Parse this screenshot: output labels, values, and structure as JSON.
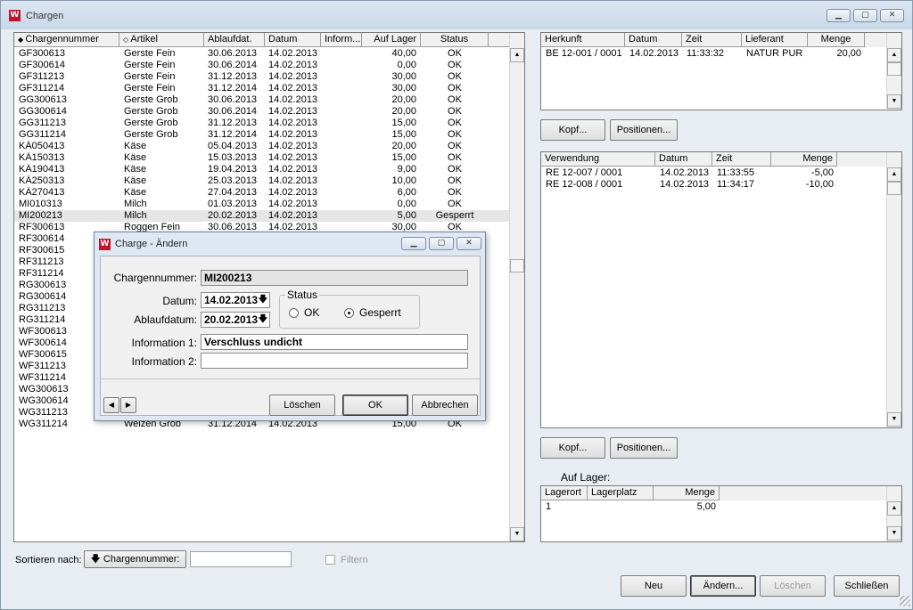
{
  "window": {
    "title": "Chargen",
    "icon": "w-app-icon",
    "controls": [
      "minimize-icon",
      "maximize-icon",
      "close-icon"
    ]
  },
  "main_table": {
    "headers": [
      "Chargennummer",
      "Artikel",
      "Ablaufdat.",
      "Datum",
      "Inform...",
      "Auf Lager",
      "Status"
    ],
    "header_markers": [
      "◆",
      "◇"
    ],
    "rows": [
      [
        "GF300613",
        "Gerste Fein",
        "30.06.2013",
        "14.02.2013",
        "",
        "40,00",
        "OK"
      ],
      [
        "GF300614",
        "Gerste Fein",
        "30.06.2014",
        "14.02.2013",
        "",
        "0,00",
        "OK"
      ],
      [
        "GF311213",
        "Gerste Fein",
        "31.12.2013",
        "14.02.2013",
        "",
        "30,00",
        "OK"
      ],
      [
        "GF311214",
        "Gerste Fein",
        "31.12.2014",
        "14.02.2013",
        "",
        "30,00",
        "OK"
      ],
      [
        "GG300613",
        "Gerste Grob",
        "30.06.2013",
        "14.02.2013",
        "",
        "20,00",
        "OK"
      ],
      [
        "GG300614",
        "Gerste Grob",
        "30.06.2014",
        "14.02.2013",
        "",
        "20,00",
        "OK"
      ],
      [
        "GG311213",
        "Gerste Grob",
        "31.12.2013",
        "14.02.2013",
        "",
        "15,00",
        "OK"
      ],
      [
        "GG311214",
        "Gerste Grob",
        "31.12.2014",
        "14.02.2013",
        "",
        "15,00",
        "OK"
      ],
      [
        "KÄ050413",
        "Käse",
        "05.04.2013",
        "14.02.2013",
        "",
        "20,00",
        "OK"
      ],
      [
        "KÄ150313",
        "Käse",
        "15.03.2013",
        "14.02.2013",
        "",
        "15,00",
        "OK"
      ],
      [
        "KÄ190413",
        "Käse",
        "19.04.2013",
        "14.02.2013",
        "",
        "9,00",
        "OK"
      ],
      [
        "KÄ250313",
        "Käse",
        "25.03.2013",
        "14.02.2013",
        "",
        "10,00",
        "OK"
      ],
      [
        "KÄ270413",
        "Käse",
        "27.04.2013",
        "14.02.2013",
        "",
        "6,00",
        "OK"
      ],
      [
        "MI010313",
        "Milch",
        "01.03.2013",
        "14.02.2013",
        "",
        "0,00",
        "OK"
      ],
      [
        "MI200213",
        "Milch",
        "20.02.2013",
        "14.02.2013",
        "",
        "5,00",
        "Gesperrt"
      ],
      [
        "RF300613",
        "Roggen Fein",
        "30.06.2013",
        "14.02.2013",
        "",
        "30,00",
        "OK"
      ],
      [
        "RF300614",
        "",
        "",
        "",
        "",
        "",
        ""
      ],
      [
        "RF300615",
        "",
        "",
        "",
        "",
        "",
        ""
      ],
      [
        "RF311213",
        "",
        "",
        "",
        "",
        "",
        ""
      ],
      [
        "RF311214",
        "",
        "",
        "",
        "",
        "",
        ""
      ],
      [
        "RG300613",
        "",
        "",
        "",
        "",
        "",
        ""
      ],
      [
        "RG300614",
        "",
        "",
        "",
        "",
        "",
        ""
      ],
      [
        "RG311213",
        "",
        "",
        "",
        "",
        "",
        ""
      ],
      [
        "RG311214",
        "",
        "",
        "",
        "",
        "",
        ""
      ],
      [
        "WF300613",
        "",
        "",
        "",
        "",
        "",
        ""
      ],
      [
        "WF300614",
        "",
        "",
        "",
        "",
        "",
        ""
      ],
      [
        "WF300615",
        "",
        "",
        "",
        "",
        "",
        ""
      ],
      [
        "WF311213",
        "",
        "",
        "",
        "",
        "",
        ""
      ],
      [
        "WF311214",
        "",
        "",
        "",
        "",
        "",
        ""
      ],
      [
        "WG300613",
        "",
        "",
        "",
        "",
        "",
        ""
      ],
      [
        "WG300614",
        "",
        "",
        "",
        "",
        "",
        ""
      ],
      [
        "WG311213",
        "",
        "",
        "",
        "",
        "",
        ""
      ],
      [
        "WG311214",
        "Weizen Grob",
        "31.12.2014",
        "14.02.2013",
        "",
        "15,00",
        "OK"
      ]
    ],
    "selected_row": "MI200213"
  },
  "herkunft_table": {
    "headers": [
      "Herkunft",
      "Datum",
      "Zeit",
      "Lieferant",
      "Menge"
    ],
    "rows": [
      [
        "BE 12-001 / 0001",
        "14.02.2013",
        "11:33:32",
        "NATUR PUR",
        "20,00"
      ]
    ]
  },
  "herkunft_buttons": {
    "kopf": "Kopf...",
    "positionen": "Positionen..."
  },
  "verwendung_table": {
    "headers": [
      "Verwendung",
      "Datum",
      "Zeit",
      "Menge"
    ],
    "rows": [
      [
        "RE 12-007 / 0001",
        "14.02.2013",
        "11:33:55",
        "-5,00"
      ],
      [
        "RE 12-008 / 0001",
        "14.02.2013",
        "11:34:17",
        "-10,00"
      ]
    ]
  },
  "verwendung_buttons": {
    "kopf": "Kopf...",
    "positionen": "Positionen..."
  },
  "lager": {
    "title": "Auf Lager:",
    "headers": [
      "Lagerort",
      "Lagerplatz",
      "Menge"
    ],
    "rows": [
      [
        "1",
        "",
        "5,00"
      ]
    ]
  },
  "sort": {
    "label": "Sortieren nach:",
    "button": "Chargennummer:",
    "arrow": "🡇",
    "input_value": "",
    "filter_label": "Filtern",
    "filter_checked": false
  },
  "footer_buttons": {
    "neu": "Neu",
    "aendern": "Ändern...",
    "loeschen": "Löschen",
    "schliessen": "Schließen"
  },
  "dialog": {
    "title": "Charge - Ändern",
    "chargennummer_label": "Chargennummer:",
    "chargennummer": "MI200213",
    "datum_label": "Datum:",
    "datum": "14.02.2013",
    "ablaufdatum_label": "Ablaufdatum:",
    "ablaufdatum": "20.02.2013",
    "status_label": "Status",
    "status_ok": "OK",
    "status_gesperrt": "Gesperrt",
    "status_selected": "Gesperrt",
    "info1_label": "Information 1:",
    "info1": "Verschluss undicht",
    "info2_label": "Information 2:",
    "info2": "",
    "buttons": {
      "loeschen": "Löschen",
      "ok": "OK",
      "abbrechen": "Abbrechen"
    }
  }
}
